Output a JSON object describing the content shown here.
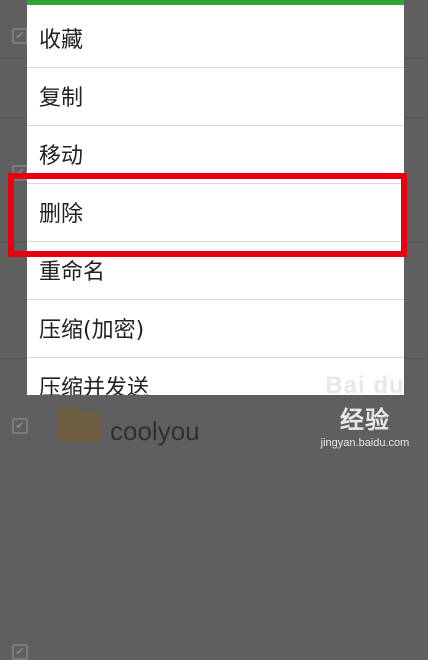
{
  "colors": {
    "dialog_accent": "#2fa336",
    "highlight": "#e60012",
    "overlay": "#5f5f5f"
  },
  "menu": {
    "items": [
      {
        "label": "收藏"
      },
      {
        "label": "复制"
      },
      {
        "label": "移动"
      },
      {
        "label": "删除",
        "highlighted": true
      },
      {
        "label": "重命名"
      },
      {
        "label": "压缩(加密)"
      },
      {
        "label": "压缩并发送"
      }
    ]
  },
  "background": {
    "visible_file_name": "coolyou",
    "checkbox_icon": "check-icon",
    "folder_icon": "folder-icon"
  },
  "watermark": {
    "title": "Bai du 经验",
    "subtitle": "jingyan.baidu.com"
  }
}
